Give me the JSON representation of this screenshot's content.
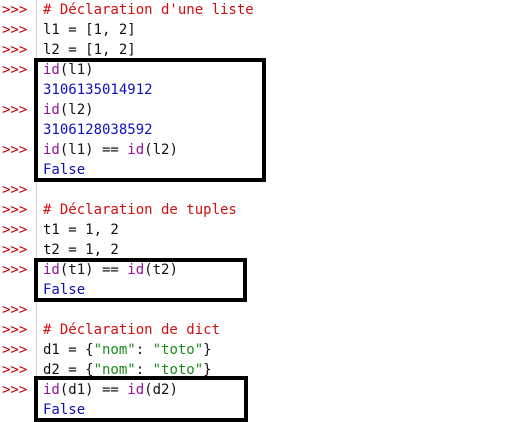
{
  "prompt": ">>>",
  "colors": {
    "prompt": "#c00000",
    "comment": "#d01010",
    "plain": "#111111",
    "builtin": "#9a109a",
    "string": "#1a8a1a",
    "output": "#1010c0",
    "highlight_box": "#000000"
  },
  "lines": [
    {
      "has_prompt": true,
      "segments": [
        {
          "text": "# Déclaration d'une liste",
          "type": "cmt"
        }
      ]
    },
    {
      "has_prompt": true,
      "segments": [
        {
          "text": "l1 = [1, 2]",
          "type": "plain"
        }
      ]
    },
    {
      "has_prompt": true,
      "segments": [
        {
          "text": "l2 = [1, 2]",
          "type": "plain"
        }
      ]
    },
    {
      "has_prompt": true,
      "segments": [
        {
          "text": "id",
          "type": "kw"
        },
        {
          "text": "(l1)",
          "type": "plain"
        }
      ]
    },
    {
      "has_prompt": false,
      "segments": [
        {
          "text": "3106135014912",
          "type": "out"
        }
      ]
    },
    {
      "has_prompt": true,
      "segments": [
        {
          "text": "id",
          "type": "kw"
        },
        {
          "text": "(l2)",
          "type": "plain"
        }
      ]
    },
    {
      "has_prompt": false,
      "segments": [
        {
          "text": "3106128038592",
          "type": "out"
        }
      ]
    },
    {
      "has_prompt": true,
      "segments": [
        {
          "text": "id",
          "type": "kw"
        },
        {
          "text": "(l1) == ",
          "type": "plain"
        },
        {
          "text": "id",
          "type": "kw"
        },
        {
          "text": "(l2)",
          "type": "plain"
        }
      ]
    },
    {
      "has_prompt": false,
      "segments": [
        {
          "text": "False",
          "type": "out"
        }
      ]
    },
    {
      "has_prompt": true,
      "segments": []
    },
    {
      "has_prompt": true,
      "segments": [
        {
          "text": "# Déclaration de tuples",
          "type": "cmt"
        }
      ]
    },
    {
      "has_prompt": true,
      "segments": [
        {
          "text": "t1 = 1, 2",
          "type": "plain"
        }
      ]
    },
    {
      "has_prompt": true,
      "segments": [
        {
          "text": "t2 = 1, 2",
          "type": "plain"
        }
      ]
    },
    {
      "has_prompt": true,
      "segments": [
        {
          "text": "id",
          "type": "kw"
        },
        {
          "text": "(t1) == ",
          "type": "plain"
        },
        {
          "text": "id",
          "type": "kw"
        },
        {
          "text": "(t2)",
          "type": "plain"
        }
      ]
    },
    {
      "has_prompt": false,
      "segments": [
        {
          "text": "False",
          "type": "out"
        }
      ]
    },
    {
      "has_prompt": true,
      "segments": []
    },
    {
      "has_prompt": true,
      "segments": [
        {
          "text": "# Déclaration de dict",
          "type": "cmt"
        }
      ]
    },
    {
      "has_prompt": true,
      "segments": [
        {
          "text": "d1 = {",
          "type": "plain"
        },
        {
          "text": "\"nom\"",
          "type": "str"
        },
        {
          "text": ": ",
          "type": "plain"
        },
        {
          "text": "\"toto\"",
          "type": "str"
        },
        {
          "text": "}",
          "type": "plain"
        }
      ]
    },
    {
      "has_prompt": true,
      "segments": [
        {
          "text": "d2 = {",
          "type": "plain"
        },
        {
          "text": "\"nom\"",
          "type": "str"
        },
        {
          "text": ": ",
          "type": "plain"
        },
        {
          "text": "\"toto\"",
          "type": "str"
        },
        {
          "text": "}",
          "type": "plain"
        }
      ]
    },
    {
      "has_prompt": true,
      "segments": [
        {
          "text": "id",
          "type": "kw"
        },
        {
          "text": "(d1) == ",
          "type": "plain"
        },
        {
          "text": "id",
          "type": "kw"
        },
        {
          "text": "(d2)",
          "type": "plain"
        }
      ]
    },
    {
      "has_prompt": false,
      "segments": [
        {
          "text": "False",
          "type": "out"
        }
      ]
    }
  ]
}
